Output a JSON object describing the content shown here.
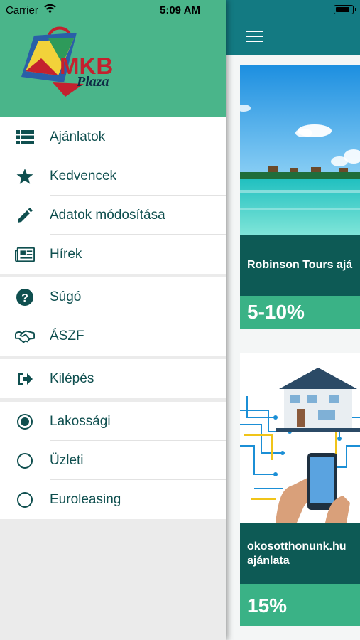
{
  "status_bar": {
    "carrier": "Carrier",
    "time": "5:09 AM"
  },
  "brand": {
    "logo_text": "MKB",
    "logo_subtext": "Plaza"
  },
  "menu": {
    "main": [
      {
        "label": "Ajánlatok",
        "icon": "list-icon"
      },
      {
        "label": "Kedvencek",
        "icon": "star-icon"
      },
      {
        "label": "Adatok módosítása",
        "icon": "pencil-icon"
      },
      {
        "label": "Hírek",
        "icon": "newspaper-icon"
      }
    ],
    "help": [
      {
        "label": "Súgó",
        "icon": "question-circle-icon"
      },
      {
        "label": "ÁSZF",
        "icon": "handshake-icon"
      }
    ],
    "logout": {
      "label": "Kilépés",
      "icon": "sign-out-icon"
    },
    "segments": [
      {
        "label": "Lakossági",
        "selected": true
      },
      {
        "label": "Üzleti",
        "selected": false
      },
      {
        "label": "Euroleasing",
        "selected": false
      }
    ]
  },
  "offers": [
    {
      "title": "Robinson Tours ajá",
      "discount": "5-10%"
    },
    {
      "title": "okosotthonunk.hu ajánlata",
      "discount": "15%"
    }
  ],
  "colors": {
    "header_teal": "#137a82",
    "drawer_green": "#4ab58a",
    "text_dark": "#0f4f4f",
    "card_title_bg": "#0d5a55",
    "card_discount_bg": "#3ab286",
    "logo_red": "#c4212e"
  }
}
